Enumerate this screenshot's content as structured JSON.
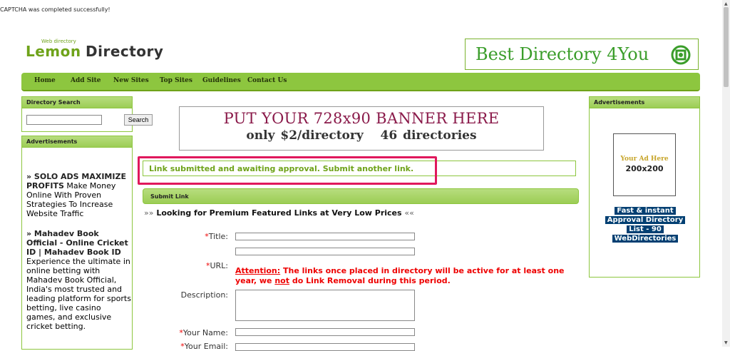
{
  "captcha_message": "CAPTCHA was completed successfully!",
  "logo": {
    "tagline": "Web directory",
    "word1": "Lemon",
    "word2": "Directory"
  },
  "top_banner": {
    "text": "Best Directory 4You"
  },
  "nav": [
    "Home",
    "Add Site",
    "New Sites",
    "Top Sites",
    "Guidelines",
    "Contact Us"
  ],
  "left": {
    "search": {
      "title": "Directory Search",
      "button": "Search",
      "value": ""
    },
    "ads": {
      "title": "Advertisements",
      "items": [
        {
          "title": "» SOLO ADS MAXIMIZE PROFITS",
          "text": "Make Money Online With Proven Strategies To Increase Website Traffic"
        },
        {
          "title": "» Mahadev Book Official - Online Cricket ID | Mahadev Book ID",
          "text": "Experience the ultimate in online betting with Mahadev Book Official, India's most trusted and leading platform for sports betting, live casino games, and exclusive cricket betting."
        }
      ]
    }
  },
  "right": {
    "ads_title": "Advertisements",
    "ad_here": "Your Ad Here",
    "ad_size": "200x200",
    "fast_ad": [
      "Fast & instant",
      "Approval Directory",
      "List - 90",
      "WebDirectories"
    ]
  },
  "center_banner": {
    "line1": "PUT YOUR 728x90 BANNER HERE",
    "line2a": "only $2/directory",
    "line2b": "46 directories"
  },
  "status": "Link submitted and awaiting approval. Submit another link.",
  "submit": {
    "header": "Submit Link",
    "premium_prefix": "»»",
    "premium": "Looking for Premium Featured Links at Very Low Prices",
    "premium_suffix": "««",
    "labels": {
      "title": "Title:",
      "url": "URL:",
      "description": "Description:",
      "your_name": "Your Name:",
      "your_email": "Your Email:"
    },
    "required_mark": "*",
    "attention": {
      "label": "Attention:",
      "text1": "The links once placed in directory will be active for at least one year, we",
      "not": "not",
      "text2": "do Link Removal during this period."
    }
  },
  "colors": {
    "accent": "#8dc63f",
    "status_text": "#6fa31a",
    "highlight": "#e0185c",
    "required": "#e00000"
  }
}
